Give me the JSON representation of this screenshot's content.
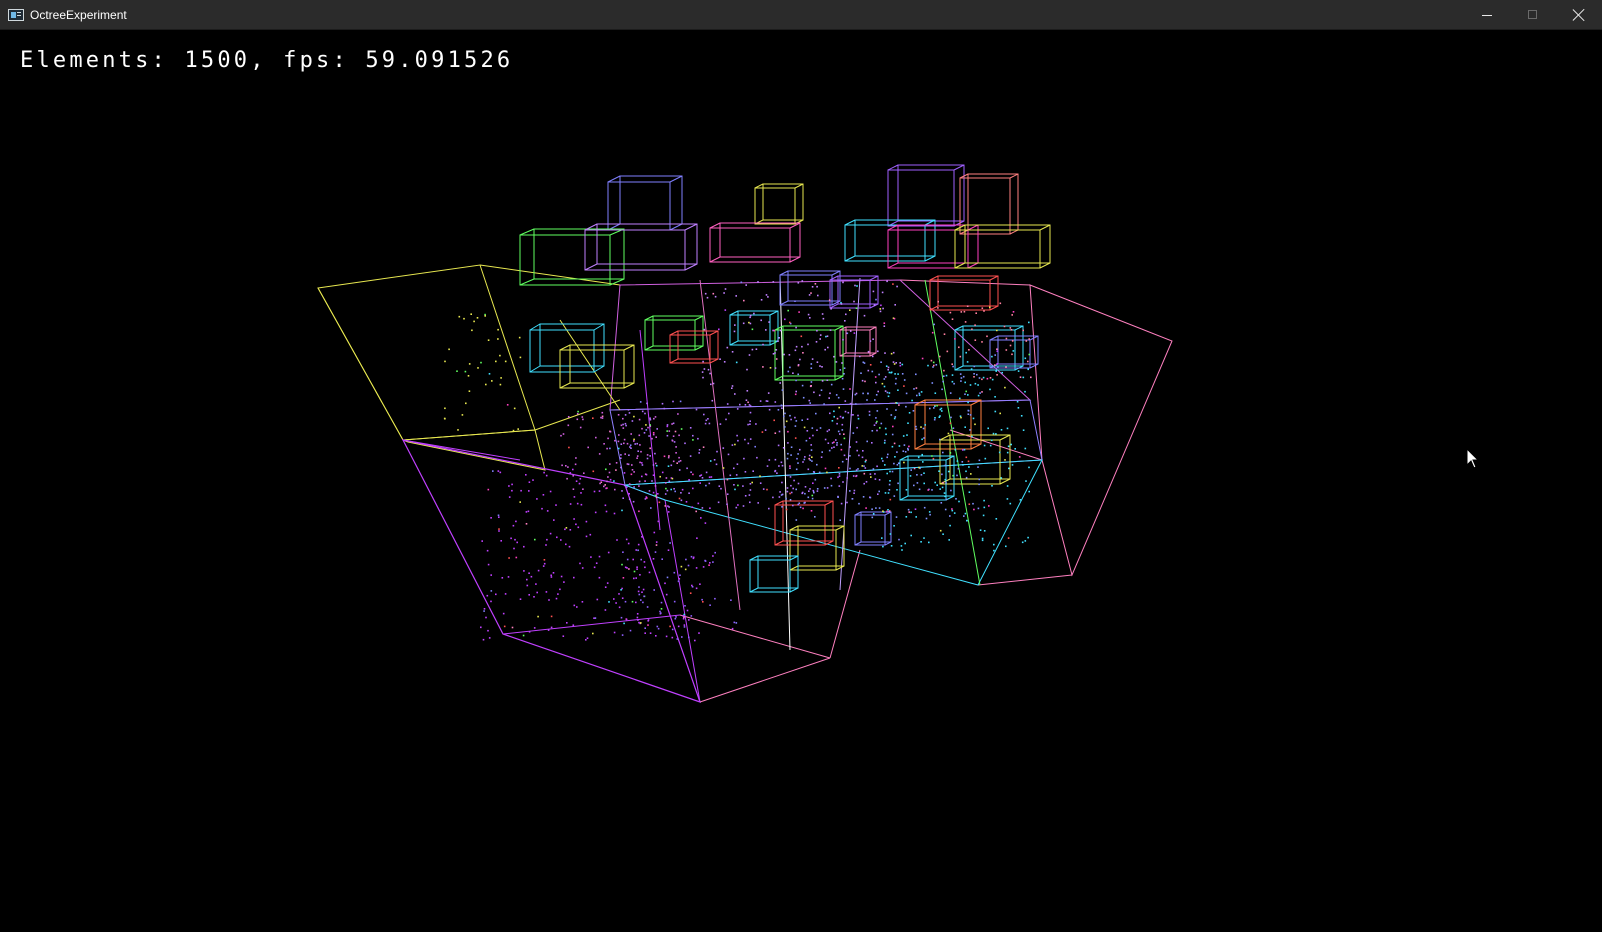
{
  "window": {
    "title": "OctreeExperiment",
    "icon": "app-window-icon",
    "controls": {
      "minimize_icon": "minimize-icon",
      "maximize_icon": "maximize-icon",
      "close_icon": "close-icon"
    }
  },
  "hud": {
    "status_text": "Elements: 1500, fps: 59.091526"
  },
  "scene": {
    "description_kind": "octree wireframe visualization",
    "background_color": "#000000",
    "palette": [
      "#c040ff",
      "#ff40c0",
      "#e8e850",
      "#40e0ff",
      "#60ff60",
      "#ff5050",
      "#8080ff",
      "#ff80c0"
    ],
    "point_count_visible": 1500
  },
  "cursor": {
    "icon": "mouse-pointer-icon"
  }
}
